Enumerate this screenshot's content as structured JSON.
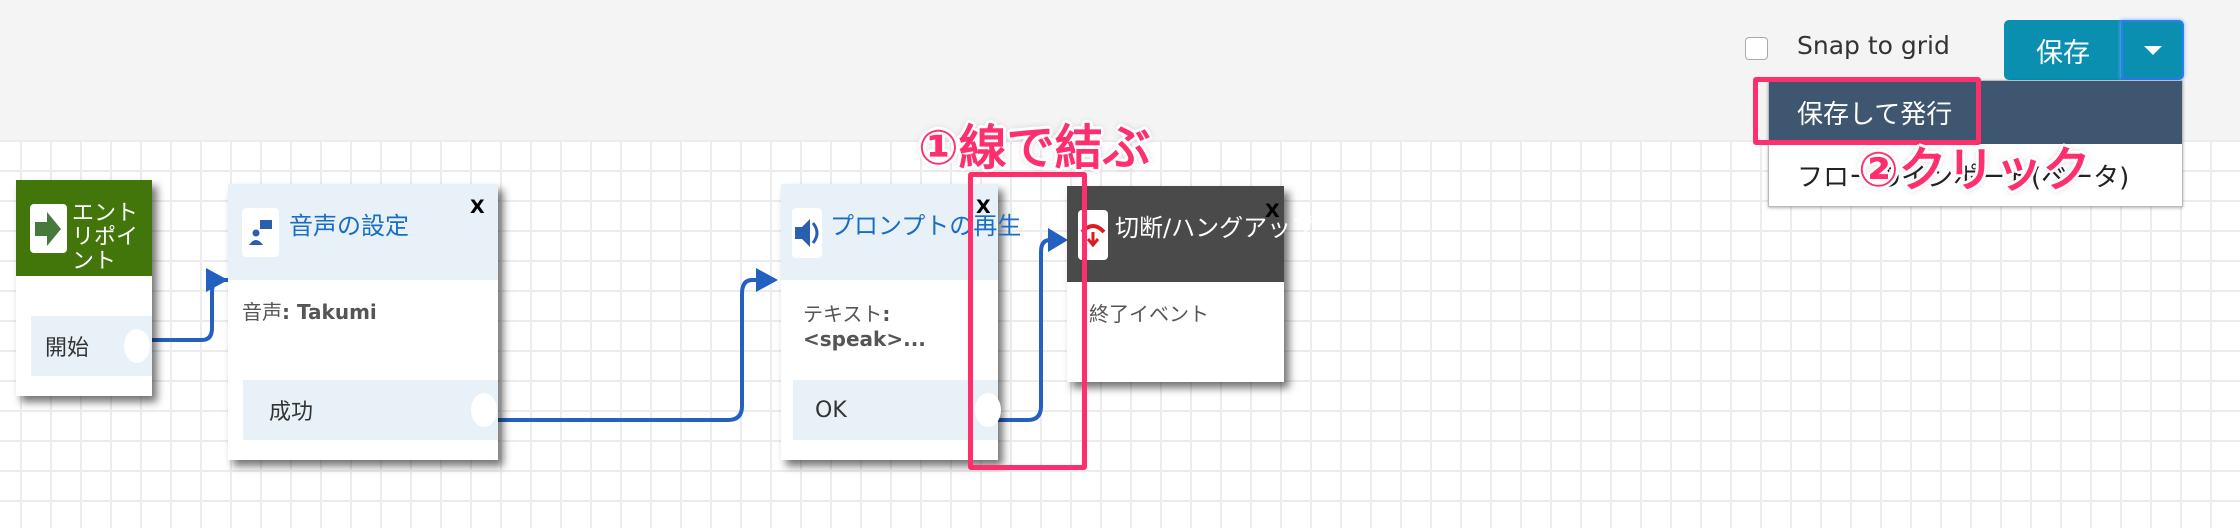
{
  "toolbar": {
    "snap_label": "Snap to grid",
    "snap_checked": false,
    "save_label": "保存"
  },
  "dropdown": {
    "items": [
      "保存して発行",
      "フローのインポート(ベータ)"
    ],
    "active_index": 0
  },
  "nodes": {
    "entry": {
      "title": "エントリポイント",
      "row": "開始",
      "color": "#42760a"
    },
    "voice": {
      "title": "音声の設定",
      "body_label": "音声",
      "body_value": "Takumi",
      "row": "成功",
      "close": "X"
    },
    "prompt": {
      "title": "プロンプトの再生",
      "body_label": "テキスト",
      "body_value": "<speak>...",
      "row": "OK",
      "close": "X"
    },
    "hangup": {
      "title": "切断/ハングアップ",
      "body": "終了イベント",
      "close": "X",
      "color": "#4a4a4a"
    }
  },
  "annotations": {
    "step1": "①線で結ぶ",
    "step2": "②クリック",
    "color": "#ff2e6d"
  },
  "colors": {
    "accent": "#0a8fb0",
    "wire": "#2460c0",
    "menu_active": "#3e5670"
  }
}
